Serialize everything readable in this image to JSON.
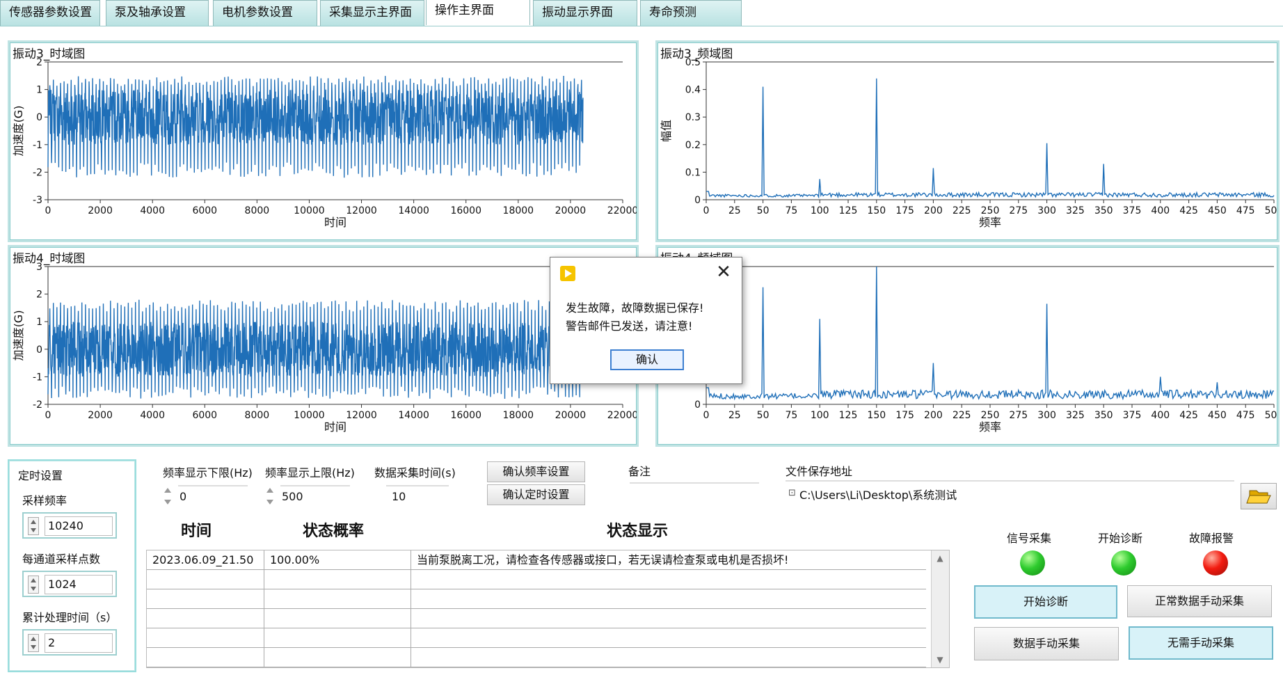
{
  "tabs": [
    {
      "label": "传感器参数设置",
      "active": false
    },
    {
      "label": "泵及轴承设置",
      "active": false
    },
    {
      "label": "电机参数设置",
      "active": false
    },
    {
      "label": "采集显示主界面",
      "active": false
    },
    {
      "label": "操作主界面",
      "active": true
    },
    {
      "label": "振动显示界面",
      "active": false
    },
    {
      "label": "寿命预测",
      "active": false
    }
  ],
  "charts": {
    "vib3_time": {
      "title": "振动3_时域图",
      "xlabel": "时间",
      "ylabel": "加速度(G)",
      "xticks": [
        "0",
        "2000",
        "4000",
        "6000",
        "8000",
        "10000",
        "12000",
        "14000",
        "16000",
        "18000",
        "20000",
        "22000"
      ],
      "yticks": [
        "2",
        "1",
        "0",
        "-1",
        "-2",
        "-3"
      ]
    },
    "vib3_freq": {
      "title": "振动3_频域图",
      "xlabel": "频率",
      "ylabel": "幅值",
      "xticks": [
        "0",
        "25",
        "50",
        "75",
        "100",
        "125",
        "150",
        "175",
        "200",
        "225",
        "250",
        "275",
        "300",
        "325",
        "350",
        "375",
        "400",
        "425",
        "450",
        "475",
        "500"
      ],
      "yticks": [
        "0.5",
        "0.4",
        "0.3",
        "0.2",
        "0.1",
        "0"
      ]
    },
    "vib4_time": {
      "title": "振动4_时域图",
      "xlabel": "时间",
      "ylabel": "加速度(G)",
      "xticks": [
        "0",
        "2000",
        "4000",
        "6000",
        "8000",
        "10000",
        "12000",
        "14000",
        "16000",
        "18000",
        "20000",
        "22000"
      ],
      "yticks": [
        "3",
        "2",
        "1",
        "0",
        "-1",
        "-2"
      ]
    },
    "vib4_freq": {
      "title": "振动4_频域图",
      "xlabel": "频率",
      "xticks": [
        "0",
        "25",
        "50",
        "75",
        "100",
        "125",
        "150",
        "175",
        "200",
        "225",
        "250",
        "275",
        "300",
        "325",
        "350",
        "375",
        "400",
        "425",
        "450",
        "475",
        "500"
      ],
      "yticks": [
        "0"
      ]
    }
  },
  "chart_data": [
    {
      "type": "line",
      "title": "振动3_时域图",
      "xlabel": "时间",
      "ylabel": "加速度(G)",
      "xlim": [
        0,
        22000
      ],
      "ylim": [
        -3,
        2
      ],
      "series_extent": {
        "x": [
          0,
          20480
        ],
        "amplitude": [
          -2.2,
          1.5
        ]
      },
      "color": "#1f6fb8"
    },
    {
      "type": "line",
      "title": "振动3_频域图",
      "xlabel": "频率",
      "ylabel": "幅值",
      "xlim": [
        0,
        500
      ],
      "ylim": [
        0,
        0.5
      ],
      "peaks": [
        {
          "x": 50,
          "y": 0.41
        },
        {
          "x": 100,
          "y": 0.075
        },
        {
          "x": 150,
          "y": 0.44
        },
        {
          "x": 200,
          "y": 0.115
        },
        {
          "x": 300,
          "y": 0.205
        },
        {
          "x": 350,
          "y": 0.13
        }
      ],
      "baseline": 0.01,
      "color": "#1f6fb8"
    },
    {
      "type": "line",
      "title": "振动4_时域图",
      "xlabel": "时间",
      "ylabel": "加速度(G)",
      "xlim": [
        0,
        22000
      ],
      "ylim": [
        -2,
        3
      ],
      "series_extent": {
        "x": [
          0,
          20480
        ],
        "amplitude": [
          -1.8,
          1.8
        ]
      },
      "color": "#1f6fb8"
    },
    {
      "type": "line",
      "title": "振动4_频域图",
      "xlabel": "频率",
      "xlim": [
        0,
        500
      ],
      "peaks": [
        {
          "x": 50,
          "y": 0.85
        },
        {
          "x": 100,
          "y": 0.62
        },
        {
          "x": 150,
          "y": 1.0
        },
        {
          "x": 200,
          "y": 0.3
        },
        {
          "x": 300,
          "y": 0.73
        },
        {
          "x": 400,
          "y": 0.2
        },
        {
          "x": 450,
          "y": 0.16
        }
      ],
      "color": "#1f6fb8"
    }
  ],
  "dialog": {
    "line1": "发生故障，故障数据已保存!",
    "line2": "警告邮件已发送，请注意!",
    "ok_label": "确认",
    "close_glyph": "✕"
  },
  "timing": {
    "group_title": "定时设置",
    "sample_rate_label": "采样频率",
    "sample_rate": "10240",
    "points_label": "每通道采样点数",
    "points": "1024",
    "cum_time_label": "累计处理时间（s）",
    "cum_time": "2"
  },
  "settings": {
    "freq_low_label": "频率显示下限(Hz)",
    "freq_low": "0",
    "freq_high_label": "频率显示上限(Hz)",
    "freq_high": "500",
    "acq_time_label": "数据采集时间(s)",
    "acq_time": "10",
    "confirm_freq": "确认频率设置",
    "confirm_timer": "确认定时设置",
    "note_label": "备注",
    "note": "",
    "path_label": "文件保存地址",
    "path": "C:\\Users\\Li\\Desktop\\系统测试"
  },
  "table": {
    "headers": [
      "时间",
      "状态概率",
      "状态显示"
    ],
    "rows": [
      [
        "2023.06.09_21.50",
        "100.00%",
        "当前泵脱离工况，请检查各传感器或接口，若无误请检查泵或电机是否损坏!"
      ],
      [
        "",
        "",
        ""
      ],
      [
        "",
        "",
        ""
      ],
      [
        "",
        "",
        ""
      ],
      [
        "",
        "",
        ""
      ],
      [
        "",
        "",
        ""
      ]
    ]
  },
  "indicators": {
    "signal_label": "信号采集",
    "diag_label": "开始诊断",
    "alarm_label": "故障报警",
    "signal_color": "#2ecb2e",
    "diag_color": "#2ecb2e",
    "alarm_color": "#f21b10"
  },
  "buttons": {
    "start_diag": "开始诊断",
    "normal_manual": "正常数据手动采集",
    "data_manual": "数据手动采集",
    "no_manual": "无需手动采集"
  }
}
